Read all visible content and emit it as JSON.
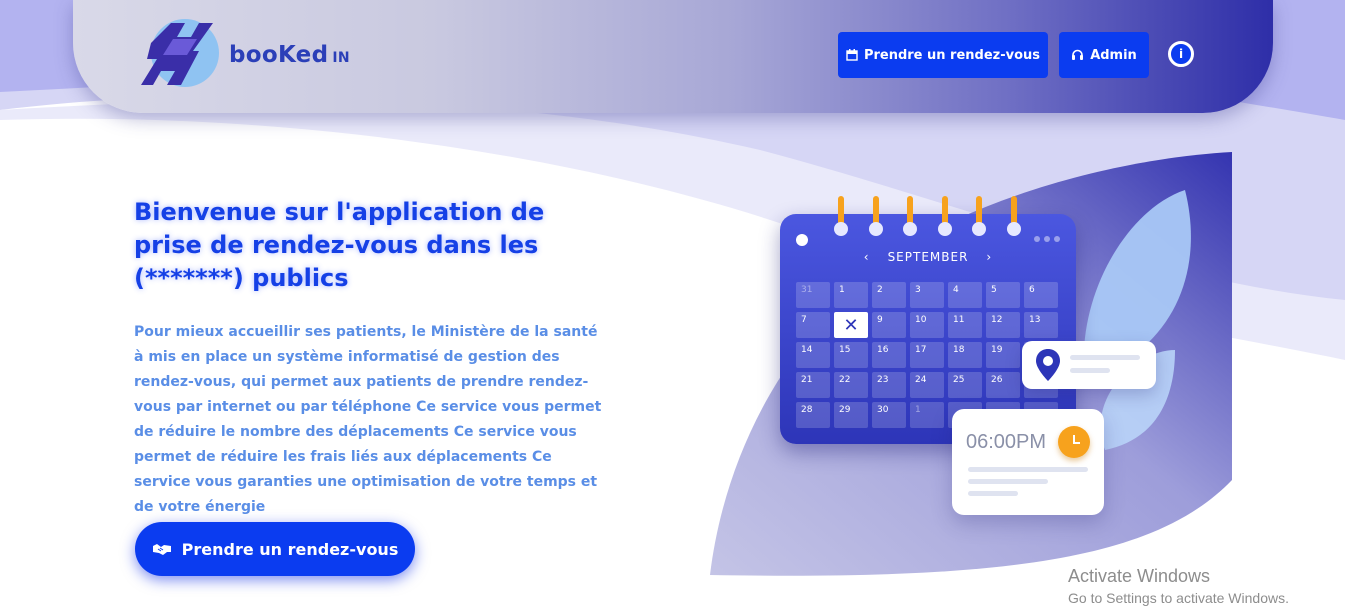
{
  "header": {
    "logo_text": "booKed",
    "logo_suffix": "IN",
    "nav_rdv_label": "Prendre un rendez-vous",
    "nav_admin_label": "Admin",
    "info_label": "i"
  },
  "hero": {
    "title": "Bienvenue sur l'application de prise de rendez-vous dans les (*******) publics",
    "description": "Pour mieux accueillir ses patients, le Ministère de la santé à mis en place un système informatisé de gestion des rendez-vous, qui permet aux patients de prendre rendez-vous par internet ou par téléphone Ce service vous permet de réduire le nombre des déplacements Ce service vous permet de réduire les frais liés aux déplacements Ce service vous garanties une optimisation de votre temps et de votre énergie",
    "cta_label": "Prendre un rendez-vous"
  },
  "calendar": {
    "month": "SEPTEMBER",
    "cells": [
      "31",
      "1",
      "2",
      "3",
      "4",
      "5",
      "6",
      "7",
      "",
      "9",
      "10",
      "11",
      "12",
      "13",
      "14",
      "15",
      "16",
      "17",
      "18",
      "19",
      "",
      "21",
      "22",
      "23",
      "24",
      "25",
      "26",
      "",
      "28",
      "29",
      "30",
      "1",
      "",
      "",
      ""
    ],
    "time": "06:00PM"
  },
  "watermark": {
    "title": "Activate Windows",
    "subtitle": "Go to Settings to activate Windows."
  },
  "colors": {
    "primary": "#0b3cf0",
    "title": "#1540e6",
    "text": "#5a8ee6",
    "accent": "#f7a21d"
  }
}
